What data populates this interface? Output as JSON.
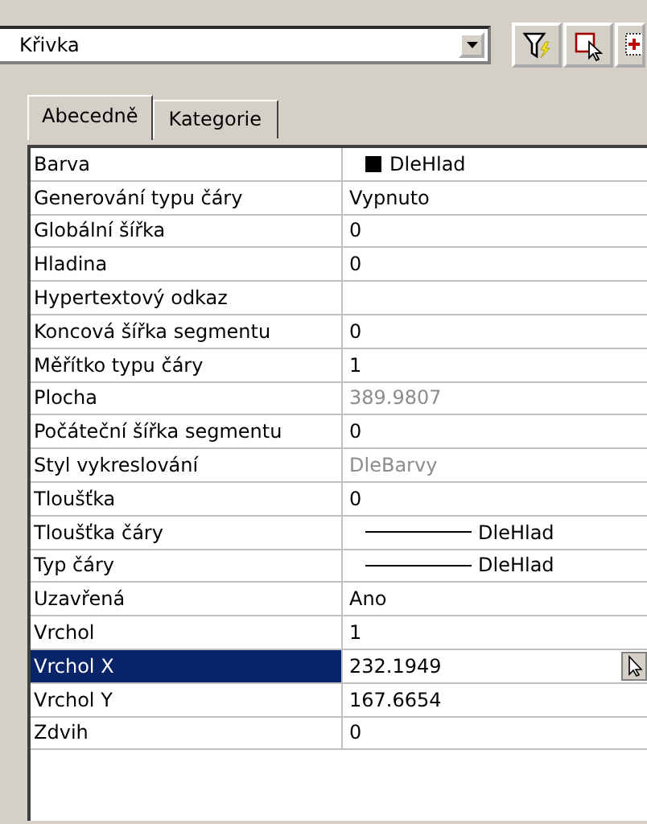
{
  "object_select": {
    "value": "Křivka"
  },
  "tabs": [
    {
      "label": "Abecedně",
      "selected": true
    },
    {
      "label": "Kategorie",
      "selected": false
    }
  ],
  "properties": [
    {
      "name": "Barva",
      "kind": "color",
      "value": "DleHlad",
      "color": "#000000",
      "disabled": false,
      "selected": false
    },
    {
      "name": "Generování typu čáry",
      "kind": "text",
      "value": "Vypnuto",
      "disabled": false,
      "selected": false
    },
    {
      "name": "Globální šířka",
      "kind": "text",
      "value": "0",
      "disabled": false,
      "selected": false
    },
    {
      "name": "Hladina",
      "kind": "text",
      "value": "0",
      "disabled": false,
      "selected": false
    },
    {
      "name": "Hypertextový odkaz",
      "kind": "text",
      "disabled": false,
      "selected": false
    },
    {
      "name": "Koncová šířka segmentu",
      "kind": "text",
      "value": "0",
      "disabled": false,
      "selected": false
    },
    {
      "name": "Měřítko typu čáry",
      "kind": "text",
      "value": "1",
      "disabled": false,
      "selected": false
    },
    {
      "name": "Plocha",
      "kind": "text",
      "value": "389.9807",
      "disabled": true,
      "selected": false
    },
    {
      "name": "Počáteční šířka segmentu",
      "kind": "text",
      "value": "0",
      "disabled": false,
      "selected": false
    },
    {
      "name": "Styl vykreslování",
      "kind": "text",
      "value": "DleBarvy",
      "disabled": true,
      "selected": false
    },
    {
      "name": "Tloušťka",
      "kind": "text",
      "value": "0",
      "disabled": false,
      "selected": false
    },
    {
      "name": "Tloušťka čáry",
      "kind": "line",
      "value": "DleHlad",
      "disabled": false,
      "selected": false
    },
    {
      "name": "Typ čáry",
      "kind": "line",
      "value": "DleHlad",
      "disabled": false,
      "selected": false
    },
    {
      "name": "Uzavřená",
      "kind": "text",
      "value": "Ano",
      "disabled": false,
      "selected": false
    },
    {
      "name": "Vrchol",
      "kind": "text",
      "value": "1",
      "disabled": false,
      "selected": false
    },
    {
      "name": "Vrchol X",
      "kind": "text",
      "value": "232.1949",
      "disabled": false,
      "selected": true
    },
    {
      "name": "Vrchol Y",
      "kind": "text",
      "value": "167.6654",
      "disabled": false,
      "selected": false
    },
    {
      "name": "Zdvih",
      "kind": "text",
      "value": "0",
      "disabled": false,
      "selected": false
    }
  ]
}
